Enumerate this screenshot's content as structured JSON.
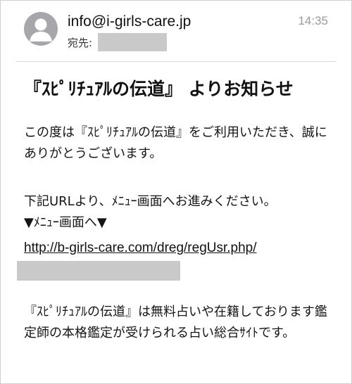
{
  "email": {
    "from": "info@i-girls-care.jp",
    "time": "14:35",
    "to_label": "宛先:",
    "subject": "『ｽﾋﾟﾘﾁｭｱﾙの伝道』 よりお知らせ",
    "body": {
      "paragraph1": "この度は『ｽﾋﾟﾘﾁｭｱﾙの伝道』をご利用いただき、誠にありがとうございます。",
      "paragraph2_line1": "下記URLより、ﾒﾆｭｰ画面へお進みください。",
      "paragraph2_line2": "▼ﾒﾆｭｰ画面へ▼",
      "link": "http://b-girls-care.com/dreg/regUsr.php/",
      "paragraph3": "『ｽﾋﾟﾘﾁｭｱﾙの伝道』は無料占いや在籍しております鑑定師の本格鑑定が受けられる占い総合ｻｲﾄです。"
    }
  },
  "colors": {
    "avatar_bg": "#a6a6ab",
    "timestamp": "#9a9a9e",
    "redaction": "#c9c9c9"
  },
  "icons": {
    "avatar": "default-person-icon"
  }
}
